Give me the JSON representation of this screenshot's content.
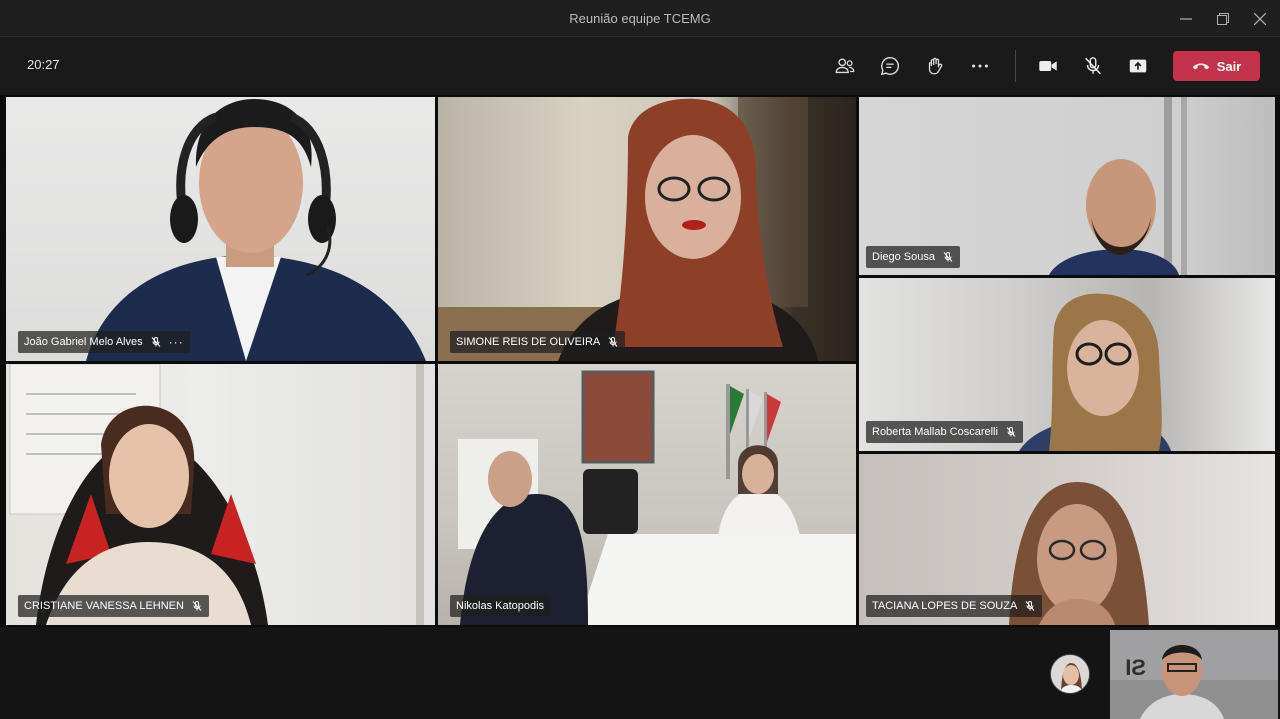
{
  "window": {
    "title": "Reunião equipe TCEMG"
  },
  "controls": {
    "timer": "20:27",
    "leave_label": "Sair",
    "icons": [
      "people-icon",
      "chat-icon",
      "raise-hand-icon",
      "more-icon",
      "camera-icon",
      "mic-off-icon",
      "share-screen-icon",
      "phone-hangup-icon"
    ],
    "leave_color": "#c4314b"
  },
  "participants": [
    {
      "name": "João Gabriel Melo Alves",
      "muted": true,
      "more": "···"
    },
    {
      "name": "SIMONE REIS DE OLIVEIRA",
      "muted": true
    },
    {
      "name": "Diego Sousa",
      "muted": true
    },
    {
      "name": "Roberta Mallab Coscarelli",
      "muted": true
    },
    {
      "name": "CRISTIANE VANESSA LEHNEN",
      "muted": true
    },
    {
      "name": "Nikolas Katopodis",
      "muted": false
    },
    {
      "name": "TACIANA LOPES DE SOUZA",
      "muted": true
    }
  ]
}
